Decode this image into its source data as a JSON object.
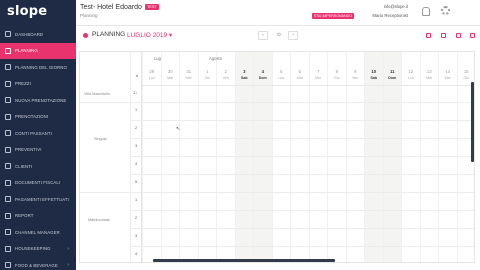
{
  "app": {
    "logo": "slope",
    "hotel_name": "Test- Hotel Edoardo",
    "test_badge": "TEST",
    "subtitle": "Planning",
    "user_email": "info@slope.it",
    "impersonate_badge": "STAI IMPERSONANDO",
    "user_name": "Mario Receptionist"
  },
  "sidebar": {
    "items": [
      {
        "label": "DASHBOARD",
        "icon": "dashboard-icon"
      },
      {
        "label": "PLANNING",
        "icon": "calendar-icon",
        "active": true
      },
      {
        "label": "PLANNING DEL GIORNO",
        "icon": "calendar-day-icon"
      },
      {
        "label": "PREZZI",
        "icon": "euro-icon"
      },
      {
        "label": "NUOVA PRENOTAZIONE",
        "icon": "plus-circle-icon"
      },
      {
        "label": "PRENOTAZIONI",
        "icon": "list-icon"
      },
      {
        "label": "CONTI PASSANTI",
        "icon": "receipt-icon"
      },
      {
        "label": "PREVENTIVI",
        "icon": "quote-icon"
      },
      {
        "label": "CLIENTI",
        "icon": "users-icon"
      },
      {
        "label": "DOCUMENTI FISCALI",
        "icon": "document-icon"
      },
      {
        "label": "PAGAMENTI EFFETTUATI",
        "icon": "payment-icon"
      },
      {
        "label": "REPORT",
        "icon": "chart-icon"
      },
      {
        "label": "CHANNEL MANAGER",
        "icon": "channel-icon"
      },
      {
        "label": "HOUSEKEEPING",
        "icon": "housekeeping-icon",
        "chevron": "›"
      },
      {
        "label": "FOOD & BEVERAGE",
        "icon": "food-icon",
        "chevron": "›"
      }
    ]
  },
  "toolbar": {
    "title": "PLANNING",
    "month": "LUGLIO 2019 ▾",
    "prev": "‹",
    "today": "⊙",
    "next": "›"
  },
  "planning": {
    "months": [
      "Lug",
      "Agosto"
    ],
    "days": [
      {
        "num": "29",
        "name": "Lun"
      },
      {
        "num": "30",
        "name": "Mar"
      },
      {
        "num": "31",
        "name": "Mer"
      },
      {
        "num": "1",
        "name": "Gio"
      },
      {
        "num": "2",
        "name": "Ven"
      },
      {
        "num": "3",
        "name": "Sab",
        "weekend": true
      },
      {
        "num": "4",
        "name": "Dom",
        "weekend": true
      },
      {
        "num": "5",
        "name": "Lun"
      },
      {
        "num": "6",
        "name": "Mar"
      },
      {
        "num": "7",
        "name": "Mer"
      },
      {
        "num": "8",
        "name": "Gio"
      },
      {
        "num": "9",
        "name": "Ven"
      },
      {
        "num": "10",
        "name": "Sab",
        "weekend": true
      },
      {
        "num": "11",
        "name": "Dom",
        "weekend": true
      },
      {
        "num": "12",
        "name": "Lun"
      },
      {
        "num": "13",
        "name": "Mar"
      },
      {
        "num": "14",
        "name": "Mer"
      },
      {
        "num": "15",
        "name": "Gio"
      }
    ],
    "header_num": "#",
    "sort_icon": "1↓",
    "room_groups": [
      "Villa Maschiello",
      "Singola",
      "Matrimoniale"
    ],
    "rooms": [
      "1",
      "2",
      "3",
      "4",
      "5",
      "1",
      "2",
      "3",
      "4"
    ]
  }
}
